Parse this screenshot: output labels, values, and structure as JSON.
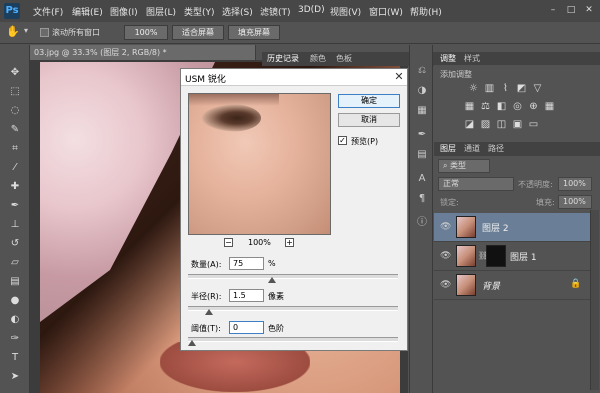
{
  "app": {
    "logo": "Ps"
  },
  "menu": [
    "文件(F)",
    "编辑(E)",
    "图像(I)",
    "图层(L)",
    "类型(Y)",
    "选择(S)",
    "滤镜(T)",
    "3D(D)",
    "视图(V)",
    "窗口(W)",
    "帮助(H)"
  ],
  "window_controls": [
    "–",
    "□",
    "✕"
  ],
  "options_bar": {
    "scroll_all": "滚动所有窗口",
    "zoom_btn": "100%",
    "fit_btn": "适合屏幕",
    "fill_btn": "填充屏幕"
  },
  "document": {
    "tab_title": "03.jpg @ 33.3% (图层 2, RGB/8) *"
  },
  "panel_tabs": [
    "历史记录",
    "颜色",
    "色板"
  ],
  "adjustments": {
    "tabs": [
      "调整",
      "样式"
    ],
    "add_label": "添加调整"
  },
  "layers": {
    "tabs": [
      "图层",
      "通道",
      "路径"
    ],
    "filter_kind": "类型",
    "blend_mode": "正常",
    "opacity_label": "不透明度:",
    "opacity_value": "100%",
    "lock_label": "锁定:",
    "fill_label": "填充:",
    "fill_value": "100%",
    "items": [
      {
        "name": "图层 2",
        "selected": true
      },
      {
        "name": "图层 1",
        "selected": false
      },
      {
        "name": "背景",
        "selected": false
      }
    ]
  },
  "dialog": {
    "title": "USM 锐化",
    "close": "✕",
    "ok": "确定",
    "cancel": "取消",
    "preview_label": "预览(P)",
    "preview_checked": true,
    "zoom": "100%",
    "zoom_out": "−",
    "zoom_in": "+",
    "amount_label": "数量(A):",
    "amount_value": "75",
    "amount_unit": "%",
    "amount_level": 0.38,
    "radius_label": "半径(R):",
    "radius_value": "1.5",
    "radius_unit": "像素",
    "radius_level": 0.08,
    "threshold_label": "阈值(T):",
    "threshold_value": "0",
    "threshold_unit": "色阶",
    "threshold_level": 0.0
  },
  "colors": {
    "selected_layer": "#6a7f97",
    "ok_border": "#3c7fc4"
  }
}
